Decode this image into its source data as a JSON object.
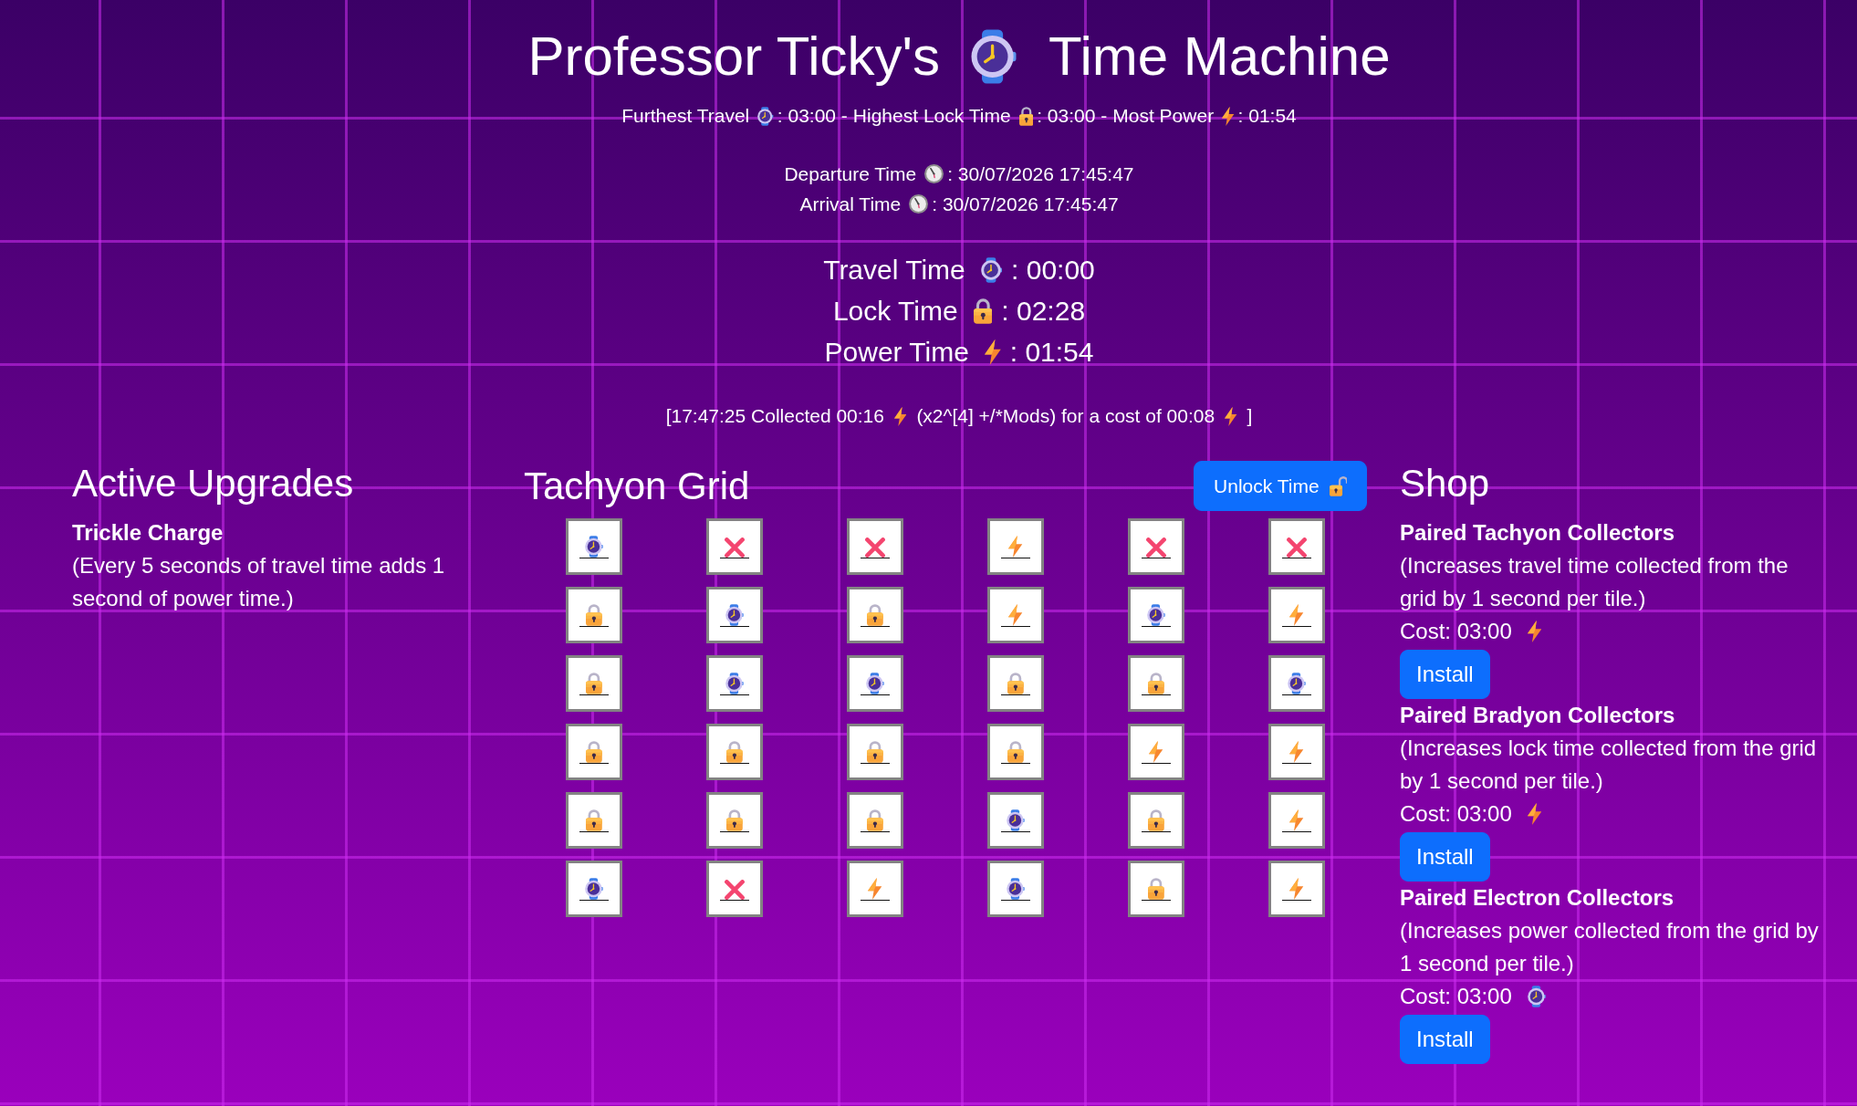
{
  "title": [
    "Professor Ticky's",
    "Time Machine"
  ],
  "records": [
    {
      "kind": "travel",
      "label": "Furthest Travel",
      "value": ": 03:00 -"
    },
    {
      "kind": "lock",
      "label": "Highest Lock Time",
      "value": ": 03:00 -"
    },
    {
      "kind": "power",
      "label": "Most Power",
      "value": ": 01:54"
    }
  ],
  "times": [
    {
      "label": "Departure Time",
      "value": ": 30/07/2026 17:45:47"
    },
    {
      "label": "Arrival Time",
      "value": ": 30/07/2026 17:45:47"
    }
  ],
  "readouts": [
    {
      "kind": "travel",
      "label": "Travel Time",
      "value": ": 00:00"
    },
    {
      "kind": "lock",
      "label": "Lock Time",
      "value": ": 02:28"
    },
    {
      "kind": "power",
      "label": "Power Time",
      "value": ": 01:54"
    }
  ],
  "log": [
    {
      "kind": "text",
      "text": "[17:47:25 Collected 00:16"
    },
    {
      "kind": "power"
    },
    {
      "kind": "text",
      "text": "(x2^[4] +/*Mods) for a cost of 00:08"
    },
    {
      "kind": "power"
    },
    {
      "kind": "text",
      "text": "]"
    }
  ],
  "upgrades": {
    "title": "Active Upgrades",
    "items": [
      {
        "name": "Trickle Charge",
        "description": "(Every 5 seconds of travel time adds 1 second of power time.)"
      }
    ]
  },
  "grid": {
    "title": "Tachyon Grid",
    "unlock_button": "Unlock Time",
    "rows": [
      [
        {
          "kind": "travel"
        },
        {
          "kind": "blocked"
        },
        {
          "kind": "blocked"
        },
        {
          "kind": "power"
        },
        {
          "kind": "blocked"
        },
        {
          "kind": "blocked"
        }
      ],
      [
        {
          "kind": "lock"
        },
        {
          "kind": "travel"
        },
        {
          "kind": "lock"
        },
        {
          "kind": "power"
        },
        {
          "kind": "travel"
        },
        {
          "kind": "power"
        }
      ],
      [
        {
          "kind": "lock"
        },
        {
          "kind": "travel"
        },
        {
          "kind": "travel"
        },
        {
          "kind": "lock"
        },
        {
          "kind": "lock"
        },
        {
          "kind": "travel"
        }
      ],
      [
        {
          "kind": "lock"
        },
        {
          "kind": "lock"
        },
        {
          "kind": "lock"
        },
        {
          "kind": "lock"
        },
        {
          "kind": "power"
        },
        {
          "kind": "power"
        }
      ],
      [
        {
          "kind": "lock"
        },
        {
          "kind": "lock"
        },
        {
          "kind": "lock"
        },
        {
          "kind": "travel"
        },
        {
          "kind": "lock"
        },
        {
          "kind": "power"
        }
      ],
      [
        {
          "kind": "travel"
        },
        {
          "kind": "blocked"
        },
        {
          "kind": "power"
        },
        {
          "kind": "travel"
        },
        {
          "kind": "lock"
        },
        {
          "kind": "power"
        }
      ]
    ]
  },
  "shop": {
    "title": "Shop",
    "items": [
      {
        "kind": "power",
        "name": "Paired Tachyon Collectors",
        "description": "(Increases travel time collected from the grid by 1 second per tile.)",
        "cost": "Cost: 03:00",
        "button": "Install"
      },
      {
        "kind": "power",
        "name": "Paired Bradyon Collectors",
        "description": "(Increases lock time collected from the grid by 1 second per tile.)",
        "cost": "Cost: 03:00",
        "button": "Install"
      },
      {
        "kind": "travel",
        "name": "Paired Electron Collectors",
        "description": "(Increases power collected from the grid by 1 second per tile.)",
        "cost": "Cost: 03:00",
        "button": "Install"
      }
    ]
  }
}
